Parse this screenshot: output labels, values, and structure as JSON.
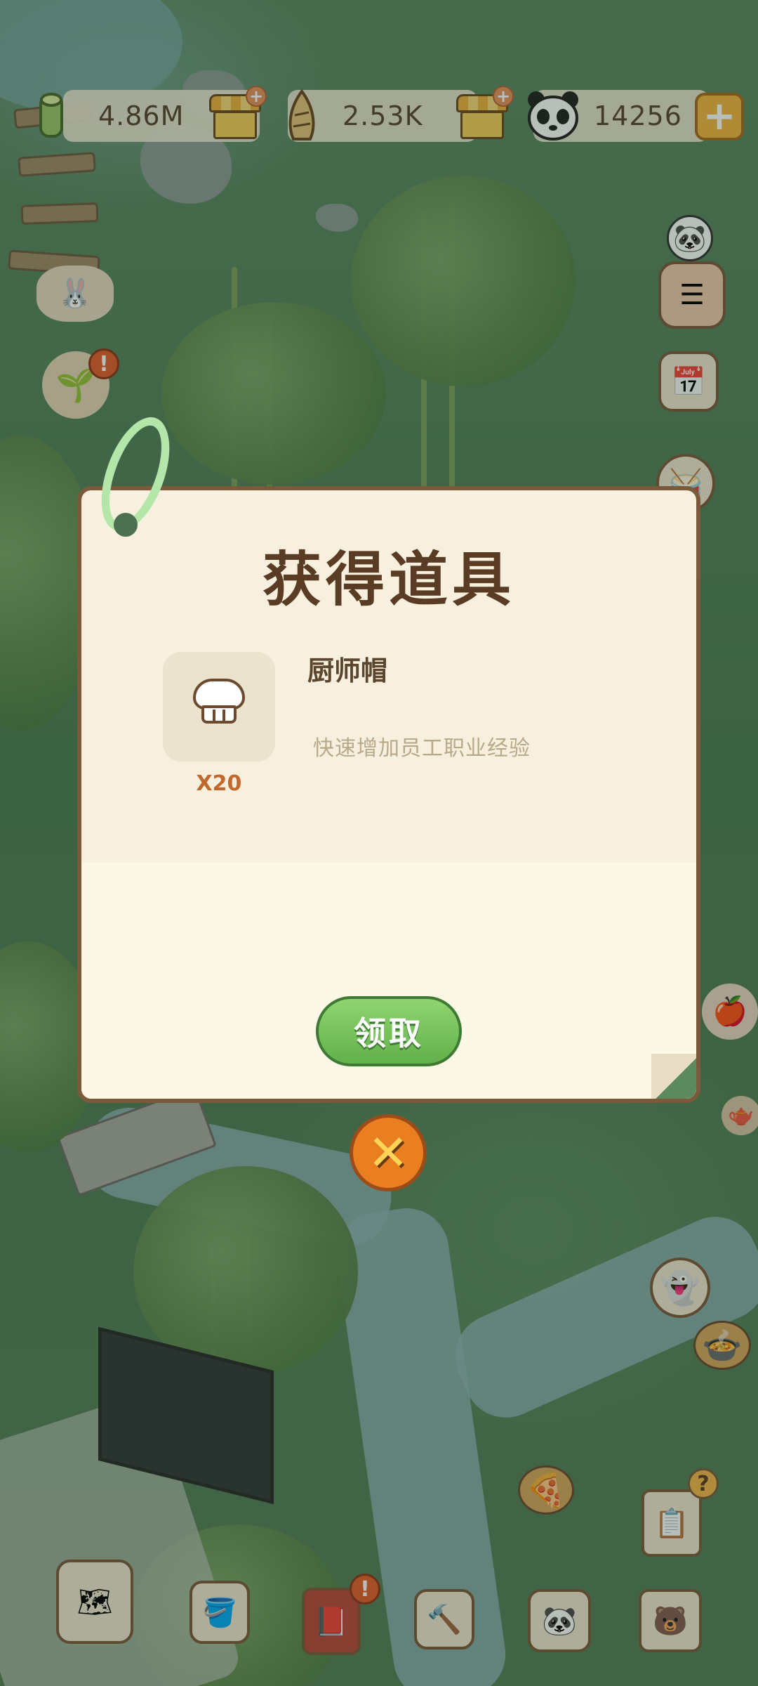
{
  "resources": {
    "bamboo": {
      "value": "4.86M",
      "icon": "bamboo-log-icon"
    },
    "shoots": {
      "value": "2.53K",
      "icon": "bamboo-shoot-icon"
    },
    "pandas": {
      "value": "14256",
      "icon": "panda-icon"
    }
  },
  "dialog": {
    "title": "获得道具",
    "item": {
      "name": "厨师帽",
      "description": "快速增加员工职业经验",
      "quantity": "X20",
      "icon": "chef-hat-icon"
    },
    "claim_label": "领取",
    "close_icon": "close-icon"
  },
  "colors": {
    "dialog_bg": "#f7f0de",
    "title": "#5a3c24",
    "claim_button": "#62b14c",
    "quantity": "#c2682c",
    "close_button": "#ea7f22"
  }
}
